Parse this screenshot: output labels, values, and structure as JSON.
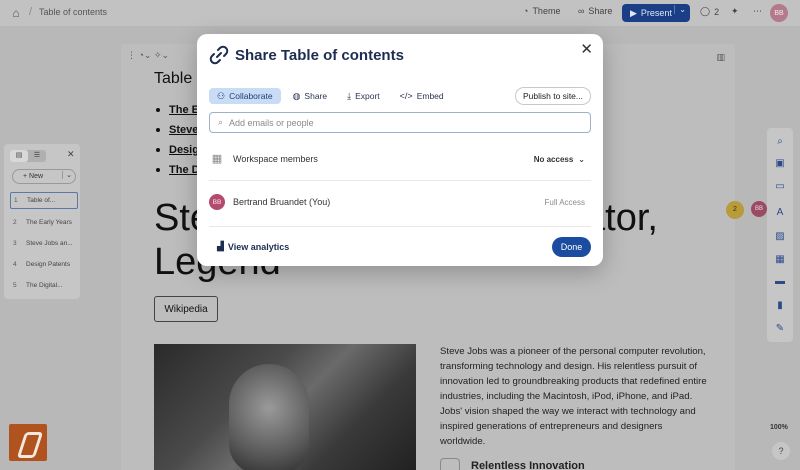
{
  "topbar": {
    "breadcrumb": "Table of contents",
    "theme_label": "Theme",
    "share_label": "Share",
    "present_label": "Present",
    "comments_count": "2",
    "user_initials": "BB"
  },
  "document": {
    "heading_small": "Table o",
    "toc_items": [
      "The Ea",
      "Steve",
      "Desig",
      "The Di"
    ],
    "big_title_line1": "Ste",
    "big_title_right": "ator,",
    "big_title_line2": "Legend",
    "wiki_button": "Wikipedia",
    "bio": "Steve Jobs was a pioneer of the personal computer revolution, transforming technology and design. His relentless pursuit of innovation led to groundbreaking products that redefined entire industries, including the Macintosh, iPod, iPhone, and iPad. Jobs' vision shaped the way we interact with technology and inspired generations of entrepreneurs and designers worldwide.",
    "subheading": "Relentless Innovation"
  },
  "slides_panel": {
    "new_label": "New",
    "items": [
      {
        "num": "1",
        "label": "Table of..."
      },
      {
        "num": "2",
        "label": "The Early Years"
      },
      {
        "num": "3",
        "label": "Steve Jobs an..."
      },
      {
        "num": "4",
        "label": "Design Patents"
      },
      {
        "num": "5",
        "label": "The Digital..."
      }
    ]
  },
  "right_rail": {
    "zoom": "100%",
    "help": "?"
  },
  "presence": {
    "count": "2",
    "user_initials": "BB"
  },
  "modal": {
    "title": "Share Table of contents",
    "tabs": [
      {
        "label": "Collaborate",
        "icon": "person-add-icon",
        "active": true
      },
      {
        "label": "Share",
        "icon": "globe-icon",
        "active": false
      },
      {
        "label": "Export",
        "icon": "download-icon",
        "active": false
      },
      {
        "label": "Embed",
        "icon": "code-icon",
        "active": false
      }
    ],
    "publish_label": "Publish to site...",
    "emails_placeholder": "Add emails or people",
    "workspace_label": "Workspace members",
    "workspace_access": "No access",
    "member_name": "Bertrand Bruandet (You)",
    "member_initials": "BB",
    "member_access": "Full Access",
    "analytics_label": "View analytics",
    "done_label": "Done"
  },
  "colors": {
    "accent": "#1a4ca0",
    "tab_active_bg": "#c9dcf6",
    "avatar": "#b44a6e"
  }
}
